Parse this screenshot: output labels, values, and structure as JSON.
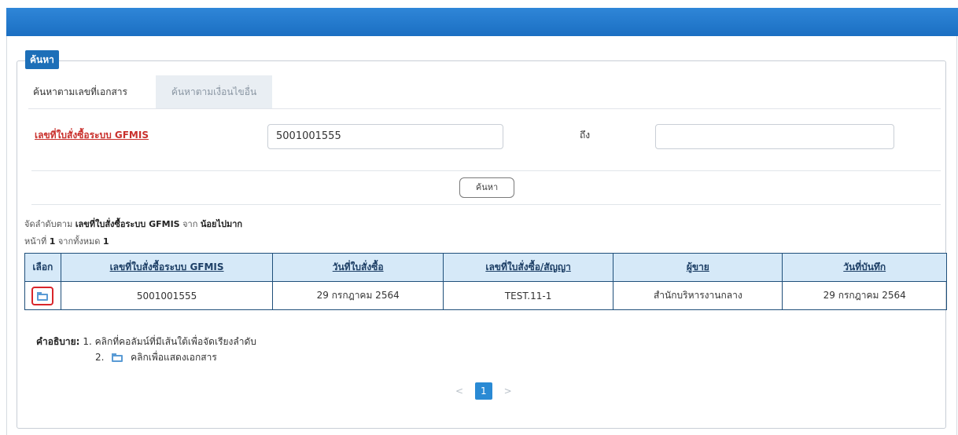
{
  "panel": {
    "title": "ค้นหา"
  },
  "tabs": [
    {
      "label": "ค้นหาตามเลขที่เอกสาร",
      "active": true
    },
    {
      "label": "ค้นหาตามเงื่อนไขอื่น",
      "active": false
    }
  ],
  "search": {
    "field_label": "เลขที่ใบสั่งซื้อระบบ GFMIS",
    "from_value": "5001001555",
    "to_label": "ถึง",
    "to_value": "",
    "button_label": "ค้นหา"
  },
  "sort_info": {
    "prefix": "จัดลำดับตาม ",
    "field": "เลขที่ใบสั่งซื้อระบบ GFMIS",
    "middle": " จาก ",
    "order": "น้อยไปมาก"
  },
  "page_info": {
    "prefix": "หน้าที่ ",
    "page": "1",
    "middle": " จากทั้งหมด ",
    "total": "1"
  },
  "table": {
    "columns": [
      "เลือก",
      "เลขที่ใบสั่งซื้อระบบ GFMIS",
      "วันที่ใบสั่งซื้อ",
      "เลขที่ใบสั่งซื้อ/สัญญา",
      "ผู้ขาย",
      "วันที่บันทึก"
    ],
    "rows": [
      [
        "",
        "5001001555",
        "29 กรกฎาคม 2564",
        "TEST.11-1",
        "สำนักบริหารงานกลาง",
        "29 กรกฎาคม 2564"
      ]
    ]
  },
  "legend": {
    "title": "คำอธิบาย:",
    "line1": "1. คลิกที่คอลัมน์ที่มีเส้นใต้เพื่อจัดเรียงลำดับ",
    "line2_prefix": "2.",
    "line2_text": "คลิกเพื่อแสดงเอกสาร"
  },
  "pagination": {
    "prev": "<",
    "current": "1",
    "next": ">"
  },
  "colors": {
    "topbar": "#1b6fc2",
    "accent": "#1d6fb8",
    "required_label": "#c9302c",
    "highlight": "#d9252a"
  }
}
